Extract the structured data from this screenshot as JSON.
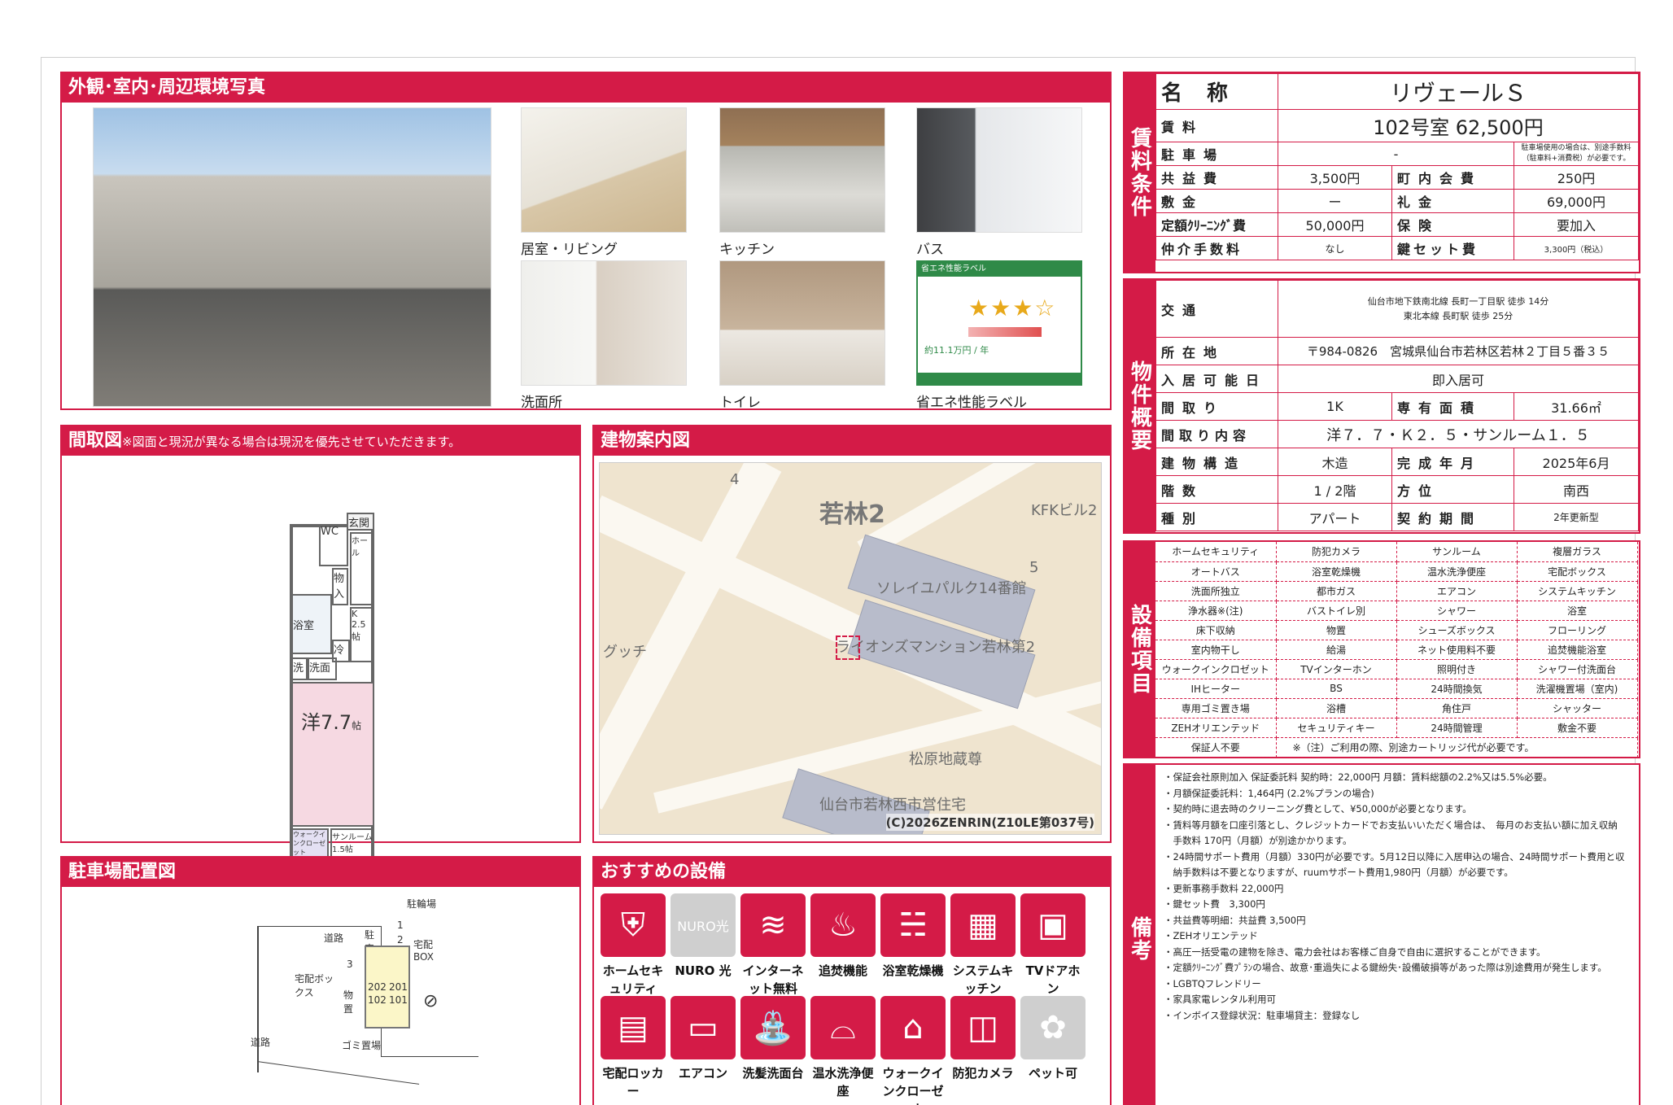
{
  "photos": {
    "title": "外観･室内･周辺環境写真",
    "items": [
      {
        "label": "居室・リビング"
      },
      {
        "label": "キッチン"
      },
      {
        "label": "バス"
      },
      {
        "label": "洗面所"
      },
      {
        "label": "トイレ"
      },
      {
        "label": "省エネ性能ラベル"
      }
    ],
    "eco_heading": "省エネ性能ラベル",
    "eco_cost": "約11.1万円 / 年"
  },
  "floorplan": {
    "title": "間取図",
    "note": "※図面と現況が異なる場合は現況を優先させていただきます。",
    "rooms": {
      "entrance": "玄関",
      "hall": "ホール",
      "wc": "WC",
      "storage": "物入",
      "bath": "浴室",
      "kitchen": "K 2.5帖",
      "fridge": "冷",
      "wash": "洗",
      "washroom": "洗面",
      "western": "洋7.7",
      "western_unit": "帖",
      "walkin": "ウォークインクローゼット",
      "sunroom": "サンルーム 1.5帖"
    }
  },
  "map": {
    "title": "建物案内図",
    "area": "若林2",
    "labels": [
      "KFKビル2",
      "ソレイユパルク14番館",
      "ライオンズマンション若林第2",
      "グッチ",
      "松原地蔵尊",
      "仙台市若林西市営住宅",
      "4",
      "5"
    ],
    "copyright": "(C)2026ZENRIN(Z10LE第037号)"
  },
  "parking": {
    "title": "駐車場配置図",
    "labels": {
      "bike": "駐輪場",
      "road_top": "道路",
      "parking": "駐車場",
      "delivery_box": "宅配BOX",
      "delivery_box2": "宅配ボックス",
      "storage": "物置",
      "road_bottom": "道路",
      "trash": "ゴミ置場",
      "n1": "1",
      "n2": "2",
      "n3": "3",
      "r202": "202",
      "r201": "201",
      "r102": "102",
      "r101": "101"
    }
  },
  "recommended": {
    "title": "おすすめの設備",
    "items": [
      {
        "label": "ホームセキュリティ",
        "icon": "shield-icon",
        "glyph": "⛨"
      },
      {
        "label": "NURO 光",
        "icon": "nuro-icon",
        "glyph": "NURO光"
      },
      {
        "label": "インターネット無料",
        "icon": "wifi-icon",
        "glyph": "≋"
      },
      {
        "label": "追焚機能",
        "icon": "bathtub-icon",
        "glyph": "♨"
      },
      {
        "label": "浴室乾燥機",
        "icon": "dryer-icon",
        "glyph": "☵"
      },
      {
        "label": "システムキッチン",
        "icon": "kitchen-icon",
        "glyph": "▦"
      },
      {
        "label": "TVドアホン",
        "icon": "intercom-icon",
        "glyph": "▣"
      },
      {
        "label": "宅配ロッカー",
        "icon": "locker-icon",
        "glyph": "▤"
      },
      {
        "label": "エアコン",
        "icon": "aircon-icon",
        "glyph": "▭"
      },
      {
        "label": "洗髪洗面台",
        "icon": "sink-icon",
        "glyph": "⛲"
      },
      {
        "label": "温水洗浄便座",
        "icon": "toilet-icon",
        "glyph": "⌓"
      },
      {
        "label": "ウォークインクローゼット",
        "icon": "closet-icon",
        "glyph": "⌂"
      },
      {
        "label": "防犯カメラ",
        "icon": "camera-icon",
        "glyph": "◫"
      },
      {
        "label": "ペット可",
        "icon": "paw-icon",
        "glyph": "✿"
      }
    ]
  },
  "rent": {
    "side": "賃料条件",
    "name_label": "名称",
    "name": "リヴェールＳ",
    "rent_label": "賃料",
    "rent": "102号室 62,500円",
    "parking_label": "駐車場",
    "parking": "-",
    "parking_note": "駐車場使用の場合は、別途手数料（駐車料+消費税）が必要です。",
    "common_label": "共益費",
    "common": "3,500円",
    "town_label": "町内会費",
    "town": "250円",
    "deposit_label": "敷金",
    "deposit": "ー",
    "key_money_label": "礼金",
    "key_money": "69,000円",
    "cleaning_label": "定額ｸﾘｰﾆﾝｸﾞ費",
    "cleaning": "50,000円",
    "insurance_label": "保険",
    "insurance": "要加入",
    "broker_label": "仲介手数料",
    "broker": "なし",
    "keyset_label": "鍵セット費",
    "keyset": "3,300円（税込）"
  },
  "property": {
    "side": "物件概要",
    "access_label": "交通",
    "access": [
      "仙台市地下鉄南北線 長町一丁目駅 徒歩 14分",
      "東北本線 長町駅 徒歩 25分"
    ],
    "address_label": "所在地",
    "address": "〒984-0826　宮城県仙台市若林区若林２丁目５番３５",
    "move_in_label": "入居可能日",
    "move_in": "即入居可",
    "layout_label": "間取り",
    "layout": "1K",
    "area_label": "専有面積",
    "area": "31.66㎡",
    "detail_label": "間取り内容",
    "detail": "洋７．７・Ｋ２．５・サンルーム１．５",
    "structure_label": "建物構造",
    "structure": "木造",
    "built_label": "完成年月",
    "built": "2025年6月",
    "floor_label": "階数",
    "floor": "1 / 2階",
    "direction_label": "方位",
    "direction": "南西",
    "type_label": "種別",
    "type": "アパート",
    "contract_label": "契約期間",
    "contract": "2年更新型"
  },
  "facilities": {
    "side": "設備項目",
    "rows": [
      [
        "ホームセキュリティ",
        "防犯カメラ",
        "サンルーム",
        "複層ガラス"
      ],
      [
        "オートバス",
        "浴室乾燥機",
        "温水洗浄便座",
        "宅配ボックス"
      ],
      [
        "洗面所独立",
        "都市ガス",
        "エアコン",
        "システムキッチン"
      ],
      [
        "浄水器※(注)",
        "バストイレ別",
        "シャワー",
        "浴室"
      ],
      [
        "床下収納",
        "物置",
        "シューズボックス",
        "フローリング"
      ],
      [
        "室内物干し",
        "給湯",
        "ネット使用料不要",
        "追焚機能浴室"
      ],
      [
        "ウォークインクロゼット",
        "TVインターホン",
        "照明付き",
        "シャワー付洗面台"
      ],
      [
        "IHヒーター",
        "BS",
        "24時間換気",
        "洗濯機置場（室内)"
      ],
      [
        "専用ゴミ置き場",
        "浴槽",
        "角住戸",
        "シャッター"
      ],
      [
        "ZEHオリエンテッド",
        "セキュリティキー",
        "24時間管理",
        "敷金不要"
      ]
    ],
    "last_left": "保証人不要",
    "last_note": "※（注）ご利用の際、別途カートリッジ代が必要です。"
  },
  "remarks": {
    "side": "備考",
    "lines": [
      "・保証会社原則加入 保証委託料 契約時：22,000円 月額：賃料総額の2.2%又は5.5%必要。",
      "・月額保証委託料：1,464円 (2.2%プランの場合)",
      "・契約時に退去時のクリーニング費として、¥50,000が必要となります。",
      "・賃料等月額を口座引落とし、クレジットカードでお支払いいただく場合は、　毎月のお支払い額に加え収納",
      "　手数料 170円（月額）が別途かかります。",
      "・24時間サポート費用（月額）330円が必要です。5月12日以降に入居申込の場合、24時間サポート費用と収",
      "　納手数料は不要となりますが、ruumサポート費用1,980円（月額）が必要です。",
      "・更新事務手数料 22,000円",
      "・鍵セット費　3,300円",
      "・共益費等明細：共益費 3,500円",
      "・ZEHオリエンテッド",
      "・高圧一括受電の建物を除き、電力会社はお客様ご自身で自由に選択することができます。",
      "・定額ｸﾘｰﾆﾝｸﾞ費ﾌﾟﾗﾝの場合、故意･重過失による鍵紛失･設備破損等があった際は別途費用が発生します。",
      "・LGBTQフレンドリー",
      "・家具家電レンタル利用可",
      "・インボイス登録状況：駐車場貸主：登録なし"
    ]
  },
  "colors": {
    "accent": "#d41b47"
  }
}
